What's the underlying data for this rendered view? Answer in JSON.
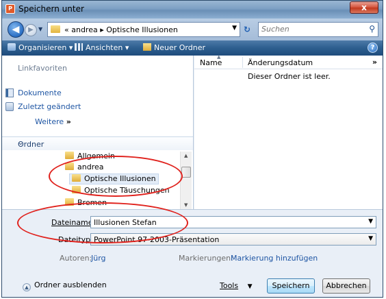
{
  "window": {
    "title": "Speichern unter",
    "close_label": "x"
  },
  "address_bar": {
    "breadcrumb_prefix": "«",
    "crumbs": [
      "andrea",
      "Optische Illusionen"
    ],
    "separator": "▸",
    "search_placeholder": "Suchen"
  },
  "toolbar": {
    "organize": "Organisieren",
    "views": "Ansichten",
    "new_folder": "Neuer Ordner",
    "help": "?"
  },
  "favorites": {
    "heading": "Linkfavoriten",
    "items": [
      "Dokumente",
      "Zuletzt geändert"
    ],
    "more": "Weitere"
  },
  "folders": {
    "heading": "Ordner",
    "tree": [
      "Allgemein",
      "andrea",
      "Optische Illusionen",
      "Optische Täuschungen",
      "Bremen"
    ],
    "selected": "Optische Illusionen"
  },
  "file_list": {
    "col_name": "Name",
    "col_date": "Änderungsdatum",
    "more_cols": "»",
    "empty_message": "Dieser Ordner ist leer."
  },
  "form": {
    "filename_label": "Dateiname:",
    "filename_value": "Illusionen Stefan",
    "filetype_label": "Dateityp:",
    "filetype_value": "PowerPoint 97-2003-Präsentation",
    "authors_label": "Autoren:",
    "authors_value": "Jürg",
    "tags_label": "Markierungen:",
    "tags_value": "Markierung hinzufügen"
  },
  "footer": {
    "hide_folders": "Ordner ausblenden",
    "tools": "Tools",
    "save": "Speichern",
    "cancel": "Abbrechen"
  },
  "colors": {
    "annotation": "#e0221d",
    "toolbar": "#2d5e8f",
    "link": "#1e55a3"
  }
}
